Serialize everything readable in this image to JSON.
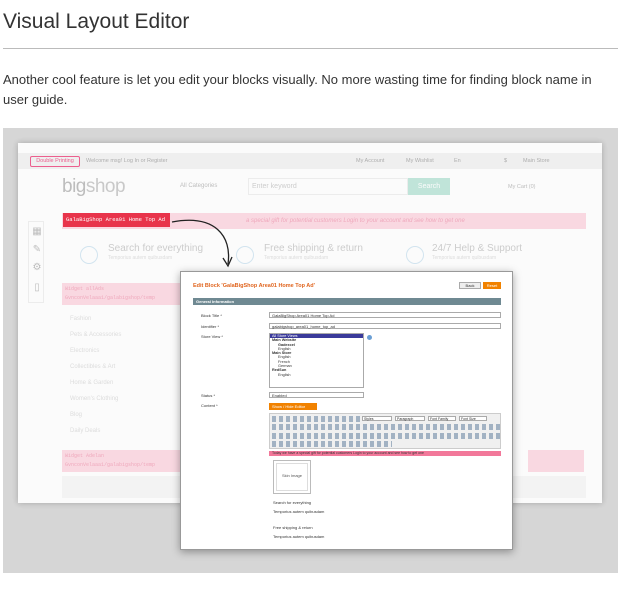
{
  "heading": "Visual Layout Editor",
  "intro": "Another cool feature is let you edit your blocks visually. No more wasting time for finding block name in user guide.",
  "colors": {
    "accent": "#e0651f",
    "label_red": "#e8344b",
    "pink": "#fcd9e2",
    "section": "#6f8992"
  },
  "site": {
    "topbar_pill": "Double Printing",
    "welcome": "Welcome msg! Log In or Register",
    "my_account": "My Account",
    "my_wishlist": "My Wishlist",
    "lang": "En",
    "currency": "$",
    "main_store": "Main Store",
    "logo_big": "big",
    "logo_shop": "shop",
    "all_categories": "All Categories",
    "keyword_placeholder": "Enter keyword",
    "search_button": "Search",
    "cart": "My Cart (0)",
    "block_label": "GalaBigShop Area01 Home Top Ad",
    "promo_text": "a special gift for potential customers Login to your account and see how to get one",
    "features": [
      {
        "title": "Search for everything",
        "sub": "Temporius autem quibusdam"
      },
      {
        "title": "Free shipping & return",
        "sub": "Temporius autem quibusdam"
      },
      {
        "title": "24/7 Help & Support",
        "sub": "Temporius autem quibusdam"
      }
    ],
    "widget_text_1": "Widget allAds GvnconVelaaa1/galabigshop/temp",
    "widget_text_2": "Widget Adelan GvnconVelaaa1/galabigshop/temp",
    "menu": [
      "Fashion",
      "Pets & Accessories",
      "Electronics",
      "Collectibles & Art",
      "Home & Garden",
      "Women's Clothing",
      "Blog",
      "Daily Deals"
    ]
  },
  "editor": {
    "title": "Edit Block 'GalaBigShop Area01 Home Top Ad'",
    "back": "Back",
    "reset": "Reset",
    "section": "General Information",
    "block_title_label": "Block Title *",
    "block_title_value": "GalaBigShop Area01 Home Top Ad",
    "identifier_label": "Identifier *",
    "identifier_value": "galabigshop_area01_home_top_ad",
    "store_view_label": "Store View *",
    "store_views": [
      {
        "text": "All Store Views",
        "style": "sel"
      },
      {
        "text": "Main Website",
        "style": "bold"
      },
      {
        "text": "Gadexcel",
        "style": "bold ind"
      },
      {
        "text": "English",
        "style": "ind"
      },
      {
        "text": "Main Store",
        "style": "bold"
      },
      {
        "text": "English",
        "style": "ind"
      },
      {
        "text": "French",
        "style": "ind"
      },
      {
        "text": "German",
        "style": "ind"
      },
      {
        "text": "RedSun",
        "style": "bold"
      },
      {
        "text": "English",
        "style": "ind"
      }
    ],
    "status_label": "Status *",
    "status_value": "Enabled",
    "content_label": "Content *",
    "wysiwyg_button": "Show / Hide Editor",
    "toolbar_styles": "Styles",
    "toolbar_paragraph": "Paragraph",
    "toolbar_font_family": "Font Family",
    "toolbar_font_size": "Font Size",
    "content_promo": "Today we have a special gift for potential customers Login to your account and see how to get one",
    "skin_image": "Skin Image",
    "content_lines": [
      "Search for everything",
      "Temporius autem quibusdam",
      "Free shipping & return",
      "Temporius autem quibusdam"
    ]
  }
}
